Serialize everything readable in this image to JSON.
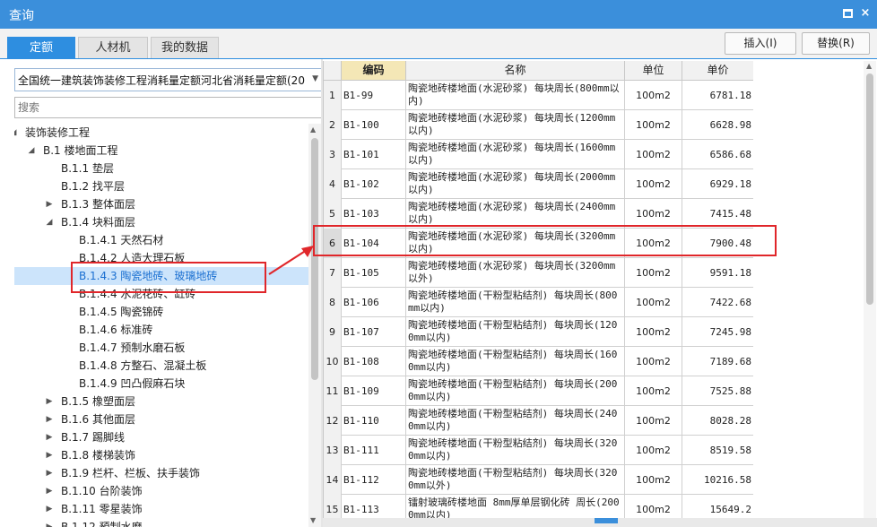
{
  "window": {
    "title": "查询",
    "maximize_icon": "maximize-icon",
    "close_glyph": "×"
  },
  "tabs": [
    {
      "label": "定额",
      "active": true
    },
    {
      "label": "人材机",
      "active": false
    },
    {
      "label": "我的数据",
      "active": false
    }
  ],
  "toolbar": {
    "insert_label": "插入(I)",
    "replace_label": "替换(R)"
  },
  "library": {
    "selected": "全国统一建筑装饰装修工程消耗量定额河北省消耗量定额(20"
  },
  "search": {
    "placeholder": "搜索"
  },
  "tree": [
    {
      "label": "装饰装修工程",
      "toggle": "◢",
      "level": 0
    },
    {
      "label": "B.1 楼地面工程",
      "toggle": "◢",
      "level": 1
    },
    {
      "label": "B.1.1 垫层",
      "toggle": "",
      "level": 2
    },
    {
      "label": "B.1.2 找平层",
      "toggle": "",
      "level": 2
    },
    {
      "label": "B.1.3 整体面层",
      "toggle": "▶",
      "level": 2
    },
    {
      "label": "B.1.4 块料面层",
      "toggle": "◢",
      "level": 2
    },
    {
      "label": "B.1.4.1 天然石材",
      "toggle": "",
      "level": 3
    },
    {
      "label": "B.1.4.2 人造大理石板",
      "toggle": "",
      "level": 3
    },
    {
      "label": "B.1.4.3 陶瓷地砖、玻璃地砖",
      "toggle": "",
      "level": 3,
      "selected": true
    },
    {
      "label": "B.1.4.4 水泥花砖、缸砖",
      "toggle": "",
      "level": 3
    },
    {
      "label": "B.1.4.5 陶瓷锦砖",
      "toggle": "",
      "level": 3
    },
    {
      "label": "B.1.4.6 标准砖",
      "toggle": "",
      "level": 3
    },
    {
      "label": "B.1.4.7 预制水磨石板",
      "toggle": "",
      "level": 3
    },
    {
      "label": "B.1.4.8 方整石、混凝土板",
      "toggle": "",
      "level": 3
    },
    {
      "label": "B.1.4.9 凹凸假麻石块",
      "toggle": "",
      "level": 3
    },
    {
      "label": "B.1.5 橡塑面层",
      "toggle": "▶",
      "level": 2
    },
    {
      "label": "B.1.6 其他面层",
      "toggle": "▶",
      "level": 2
    },
    {
      "label": "B.1.7 踢脚线",
      "toggle": "▶",
      "level": 2
    },
    {
      "label": "B.1.8 楼梯装饰",
      "toggle": "▶",
      "level": 2
    },
    {
      "label": "B.1.9 栏杆、栏板、扶手装饰",
      "toggle": "▶",
      "level": 2
    },
    {
      "label": "B.1.10 台阶装饰",
      "toggle": "▶",
      "level": 2
    },
    {
      "label": "B.1.11 零星装饰",
      "toggle": "▶",
      "level": 2
    },
    {
      "label": "B.1.12 預制水磨",
      "toggle": "▶",
      "level": 2
    }
  ],
  "grid": {
    "headers": {
      "code": "编码",
      "name": "名称",
      "unit": "单位",
      "price": "单价"
    },
    "rows": [
      {
        "idx": "1",
        "code": "B1-99",
        "name": "陶瓷地砖楼地面(水泥砂浆) 每块周长(800mm以内)",
        "unit": "100m2",
        "price": "6781.18"
      },
      {
        "idx": "2",
        "code": "B1-100",
        "name": "陶瓷地砖楼地面(水泥砂浆) 每块周长(1200mm以内)",
        "unit": "100m2",
        "price": "6628.98"
      },
      {
        "idx": "3",
        "code": "B1-101",
        "name": "陶瓷地砖楼地面(水泥砂浆) 每块周长(1600mm以内)",
        "unit": "100m2",
        "price": "6586.68"
      },
      {
        "idx": "4",
        "code": "B1-102",
        "name": "陶瓷地砖楼地面(水泥砂浆) 每块周长(2000mm以内)",
        "unit": "100m2",
        "price": "6929.18"
      },
      {
        "idx": "5",
        "code": "B1-103",
        "name": "陶瓷地砖楼地面(水泥砂浆) 每块周长(2400mm以内)",
        "unit": "100m2",
        "price": "7415.48"
      },
      {
        "idx": "6",
        "code": "B1-104",
        "name": "陶瓷地砖楼地面(水泥砂浆) 每块周长(3200mm以内)",
        "unit": "100m2",
        "price": "7900.48",
        "highlight": true
      },
      {
        "idx": "7",
        "code": "B1-105",
        "name": "陶瓷地砖楼地面(水泥砂浆) 每块周长(3200mm以外)",
        "unit": "100m2",
        "price": "9591.18"
      },
      {
        "idx": "8",
        "code": "B1-106",
        "name": "陶瓷地砖楼地面(干粉型粘结剂) 每块周长(800mm以内)",
        "unit": "100m2",
        "price": "7422.68"
      },
      {
        "idx": "9",
        "code": "B1-107",
        "name": "陶瓷地砖楼地面(干粉型粘结剂) 每块周长(1200mm以内)",
        "unit": "100m2",
        "price": "7245.98"
      },
      {
        "idx": "10",
        "code": "B1-108",
        "name": "陶瓷地砖楼地面(干粉型粘结剂) 每块周长(1600mm以内)",
        "unit": "100m2",
        "price": "7189.68"
      },
      {
        "idx": "11",
        "code": "B1-109",
        "name": "陶瓷地砖楼地面(干粉型粘结剂) 每块周长(2000mm以内)",
        "unit": "100m2",
        "price": "7525.88"
      },
      {
        "idx": "12",
        "code": "B1-110",
        "name": "陶瓷地砖楼地面(干粉型粘结剂) 每块周长(2400mm以内)",
        "unit": "100m2",
        "price": "8028.28"
      },
      {
        "idx": "13",
        "code": "B1-111",
        "name": "陶瓷地砖楼地面(干粉型粘结剂) 每块周长(3200mm以内)",
        "unit": "100m2",
        "price": "8519.58"
      },
      {
        "idx": "14",
        "code": "B1-112",
        "name": "陶瓷地砖楼地面(干粉型粘结剂) 每块周长(3200mm以外)",
        "unit": "100m2",
        "price": "10216.58"
      },
      {
        "idx": "15",
        "code": "B1-113",
        "name": "镭射玻璃砖楼地面 8mm厚单层钢化砖 周长(2000mm以内)",
        "unit": "100m2",
        "price": "15649.2"
      }
    ]
  },
  "colors": {
    "accent": "#3b8fdb",
    "highlight_box": "#e0262a",
    "header_key": "#f4e7b6",
    "tree_selected": "#cce4fb"
  }
}
